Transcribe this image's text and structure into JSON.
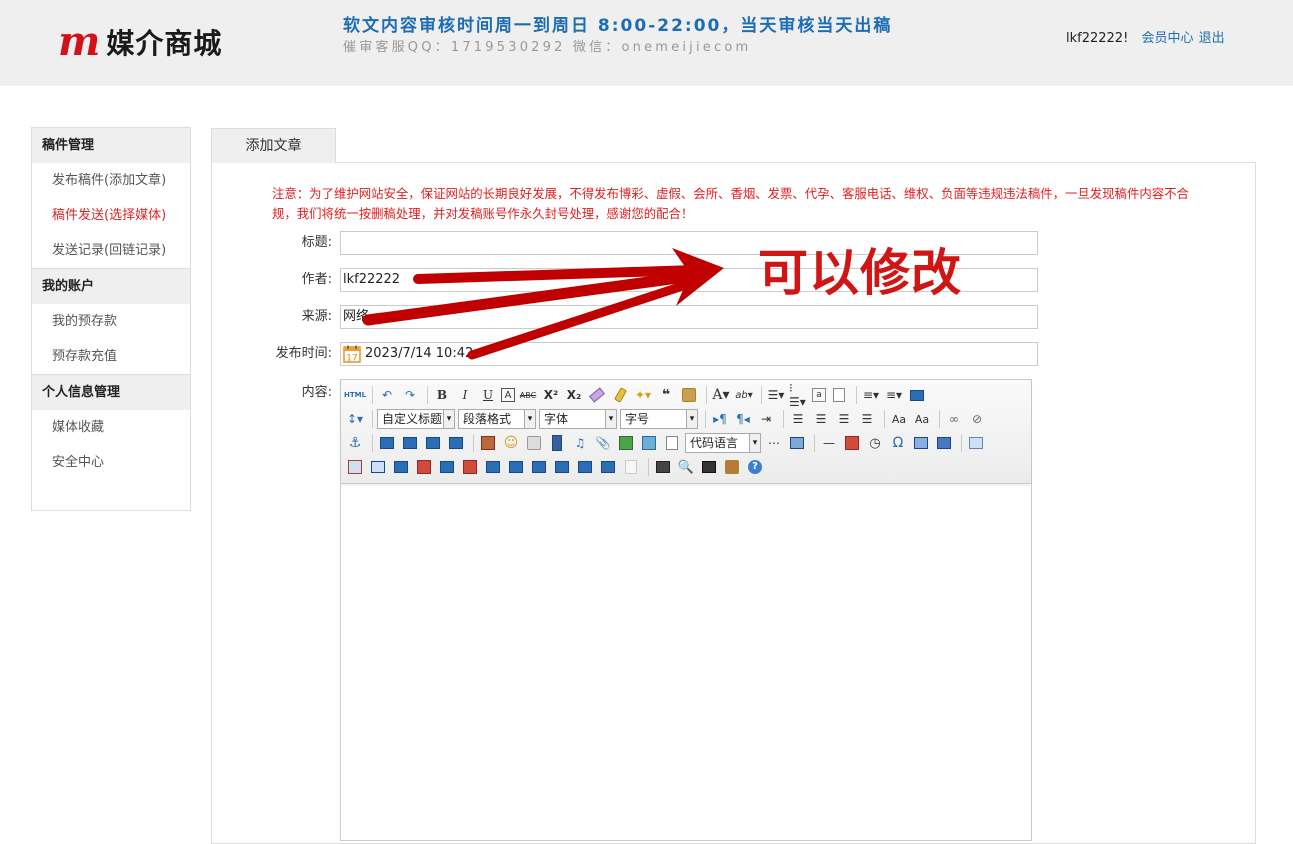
{
  "header": {
    "logo_mark": "m",
    "logo_text": "媒介商城",
    "notice_line1": "软文内容审核时间周一到周日 8:00-22:00，当天审核当天出稿",
    "notice_line2": "催审客服QQ：1719530292 微信：onemeijiecom",
    "username": "lkf22222!",
    "member_center": "会员中心",
    "logout": "退出"
  },
  "sidebar": {
    "groups": [
      {
        "title": "稿件管理",
        "items": [
          "发布稿件(添加文章)",
          "稿件发送(选择媒体)",
          "发送记录(回链记录)"
        ]
      },
      {
        "title": "我的账户",
        "items": [
          "我的预存款",
          "预存款充值"
        ]
      },
      {
        "title": "个人信息管理",
        "items": [
          "媒体收藏",
          "安全中心"
        ]
      }
    ]
  },
  "tab": {
    "label": "添加文章"
  },
  "form": {
    "warning": "注意：为了维护网站安全，保证网站的长期良好发展，不得发布博彩、虚假、会所、香烟、发票、代孕、客服电话、维权、负面等违规违法稿件，一旦发现稿件内容不合规，我们将统一按删稿处理，并对发稿账号作永久封号处理，感谢您的配合！",
    "title_label": "标题:",
    "title_value": "",
    "author_label": "作者:",
    "author_value": "lkf22222",
    "source_label": "来源:",
    "source_value": "网络",
    "time_label": "发布时间:",
    "time_value": "2023/7/14 10:42",
    "calendar_day": "17",
    "content_label": "内容:"
  },
  "toolbar": {
    "html_btn": "HTML",
    "custom_heading": "自定义标题",
    "paragraph": "段落格式",
    "font": "字体",
    "font_size": "字号",
    "code_lang": "代码语言"
  },
  "annotation": {
    "text": "可以修改",
    "color": "#d01515"
  }
}
